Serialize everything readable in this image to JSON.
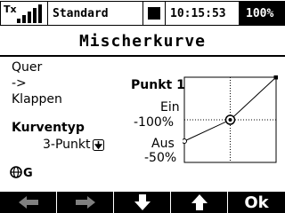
{
  "status_bar": {
    "tx_label": "Tx",
    "model_name": "Standard",
    "time": "10:15:53",
    "battery": "100%"
  },
  "page": {
    "title": "Mischerkurve"
  },
  "mixer": {
    "from": "Quer",
    "arrow": "->",
    "to": "Klappen"
  },
  "curve_type": {
    "label": "Kurventyp",
    "value": "3-Punkt"
  },
  "point": {
    "label": "Punkt 1",
    "state_label": "Ein",
    "state_value": "-100%",
    "off_label": "Aus",
    "off_value": "-50%"
  },
  "curve": {
    "points": [
      {
        "input": -100,
        "output": -50
      },
      {
        "input": 0,
        "output": 0
      },
      {
        "input": 100,
        "output": 100
      }
    ],
    "selected_point": 1
  },
  "softkeys": [
    {
      "icon": "left-arrow",
      "enabled": false
    },
    {
      "icon": "right-arrow",
      "enabled": false
    },
    {
      "icon": "down-arrow",
      "enabled": true
    },
    {
      "icon": "up-arrow",
      "enabled": true
    },
    {
      "label": "Ok",
      "enabled": true
    }
  ]
}
